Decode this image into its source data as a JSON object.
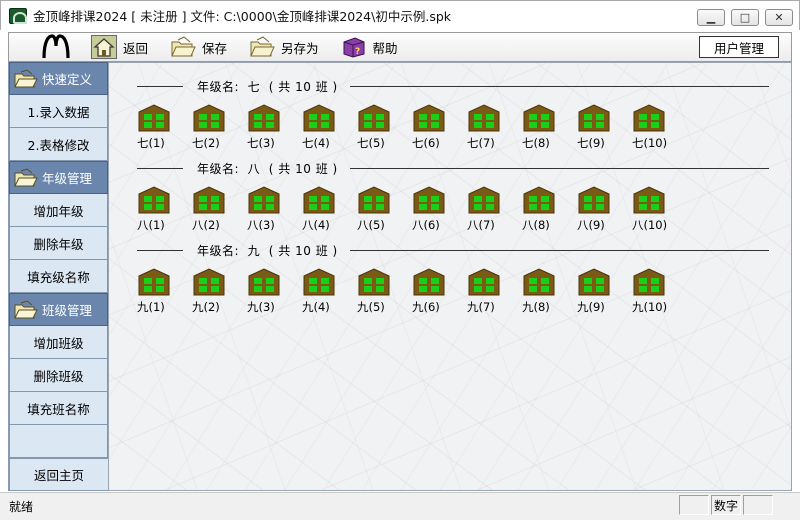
{
  "window": {
    "title": "金顶峰排课2024 [ 未注册 ] 文件: C:\\0000\\金顶峰排课2024\\初中示例.spk",
    "minimize_glyph": "▁",
    "maximize_glyph": "□",
    "close_glyph": "✕"
  },
  "toolbar": {
    "items": [
      {
        "label": "返回",
        "icon": "home-icon"
      },
      {
        "label": "保存",
        "icon": "folder-icon"
      },
      {
        "label": "另存为",
        "icon": "folder-icon"
      },
      {
        "label": "帮助",
        "icon": "help-book-icon"
      }
    ],
    "user_button": "用户管理"
  },
  "sidebar": {
    "sections": [
      {
        "header": "快速定义",
        "items": [
          "1.录入数据",
          "2.表格修改"
        ]
      },
      {
        "header": "年级管理",
        "items": [
          "增加年级",
          "删除年级",
          "填充级名称"
        ]
      },
      {
        "header": "班级管理",
        "items": [
          "增加班级",
          "删除班级",
          "填充班名称"
        ]
      }
    ],
    "back_label": "返回主页"
  },
  "grades": [
    {
      "header": "年级名:  七  ( 共 10 班 )",
      "classes": [
        "七(1)",
        "七(2)",
        "七(3)",
        "七(4)",
        "七(5)",
        "七(6)",
        "七(7)",
        "七(8)",
        "七(9)",
        "七(10)"
      ]
    },
    {
      "header": "年级名:  八  ( 共 10 班 )",
      "classes": [
        "八(1)",
        "八(2)",
        "八(3)",
        "八(4)",
        "八(5)",
        "八(6)",
        "八(7)",
        "八(8)",
        "八(9)",
        "八(10)"
      ]
    },
    {
      "header": "年级名:  九  ( 共 10 班 )",
      "classes": [
        "九(1)",
        "九(2)",
        "九(3)",
        "九(4)",
        "九(5)",
        "九(6)",
        "九(7)",
        "九(8)",
        "九(9)",
        "九(10)"
      ]
    }
  ],
  "status": {
    "text": "就绪",
    "num_label": "数字"
  },
  "colors": {
    "house_roof": "#7a5a14",
    "house_window": "#18d018",
    "sidebar_header": "#6b86ad",
    "sidebar_bg": "#dce7f4"
  }
}
